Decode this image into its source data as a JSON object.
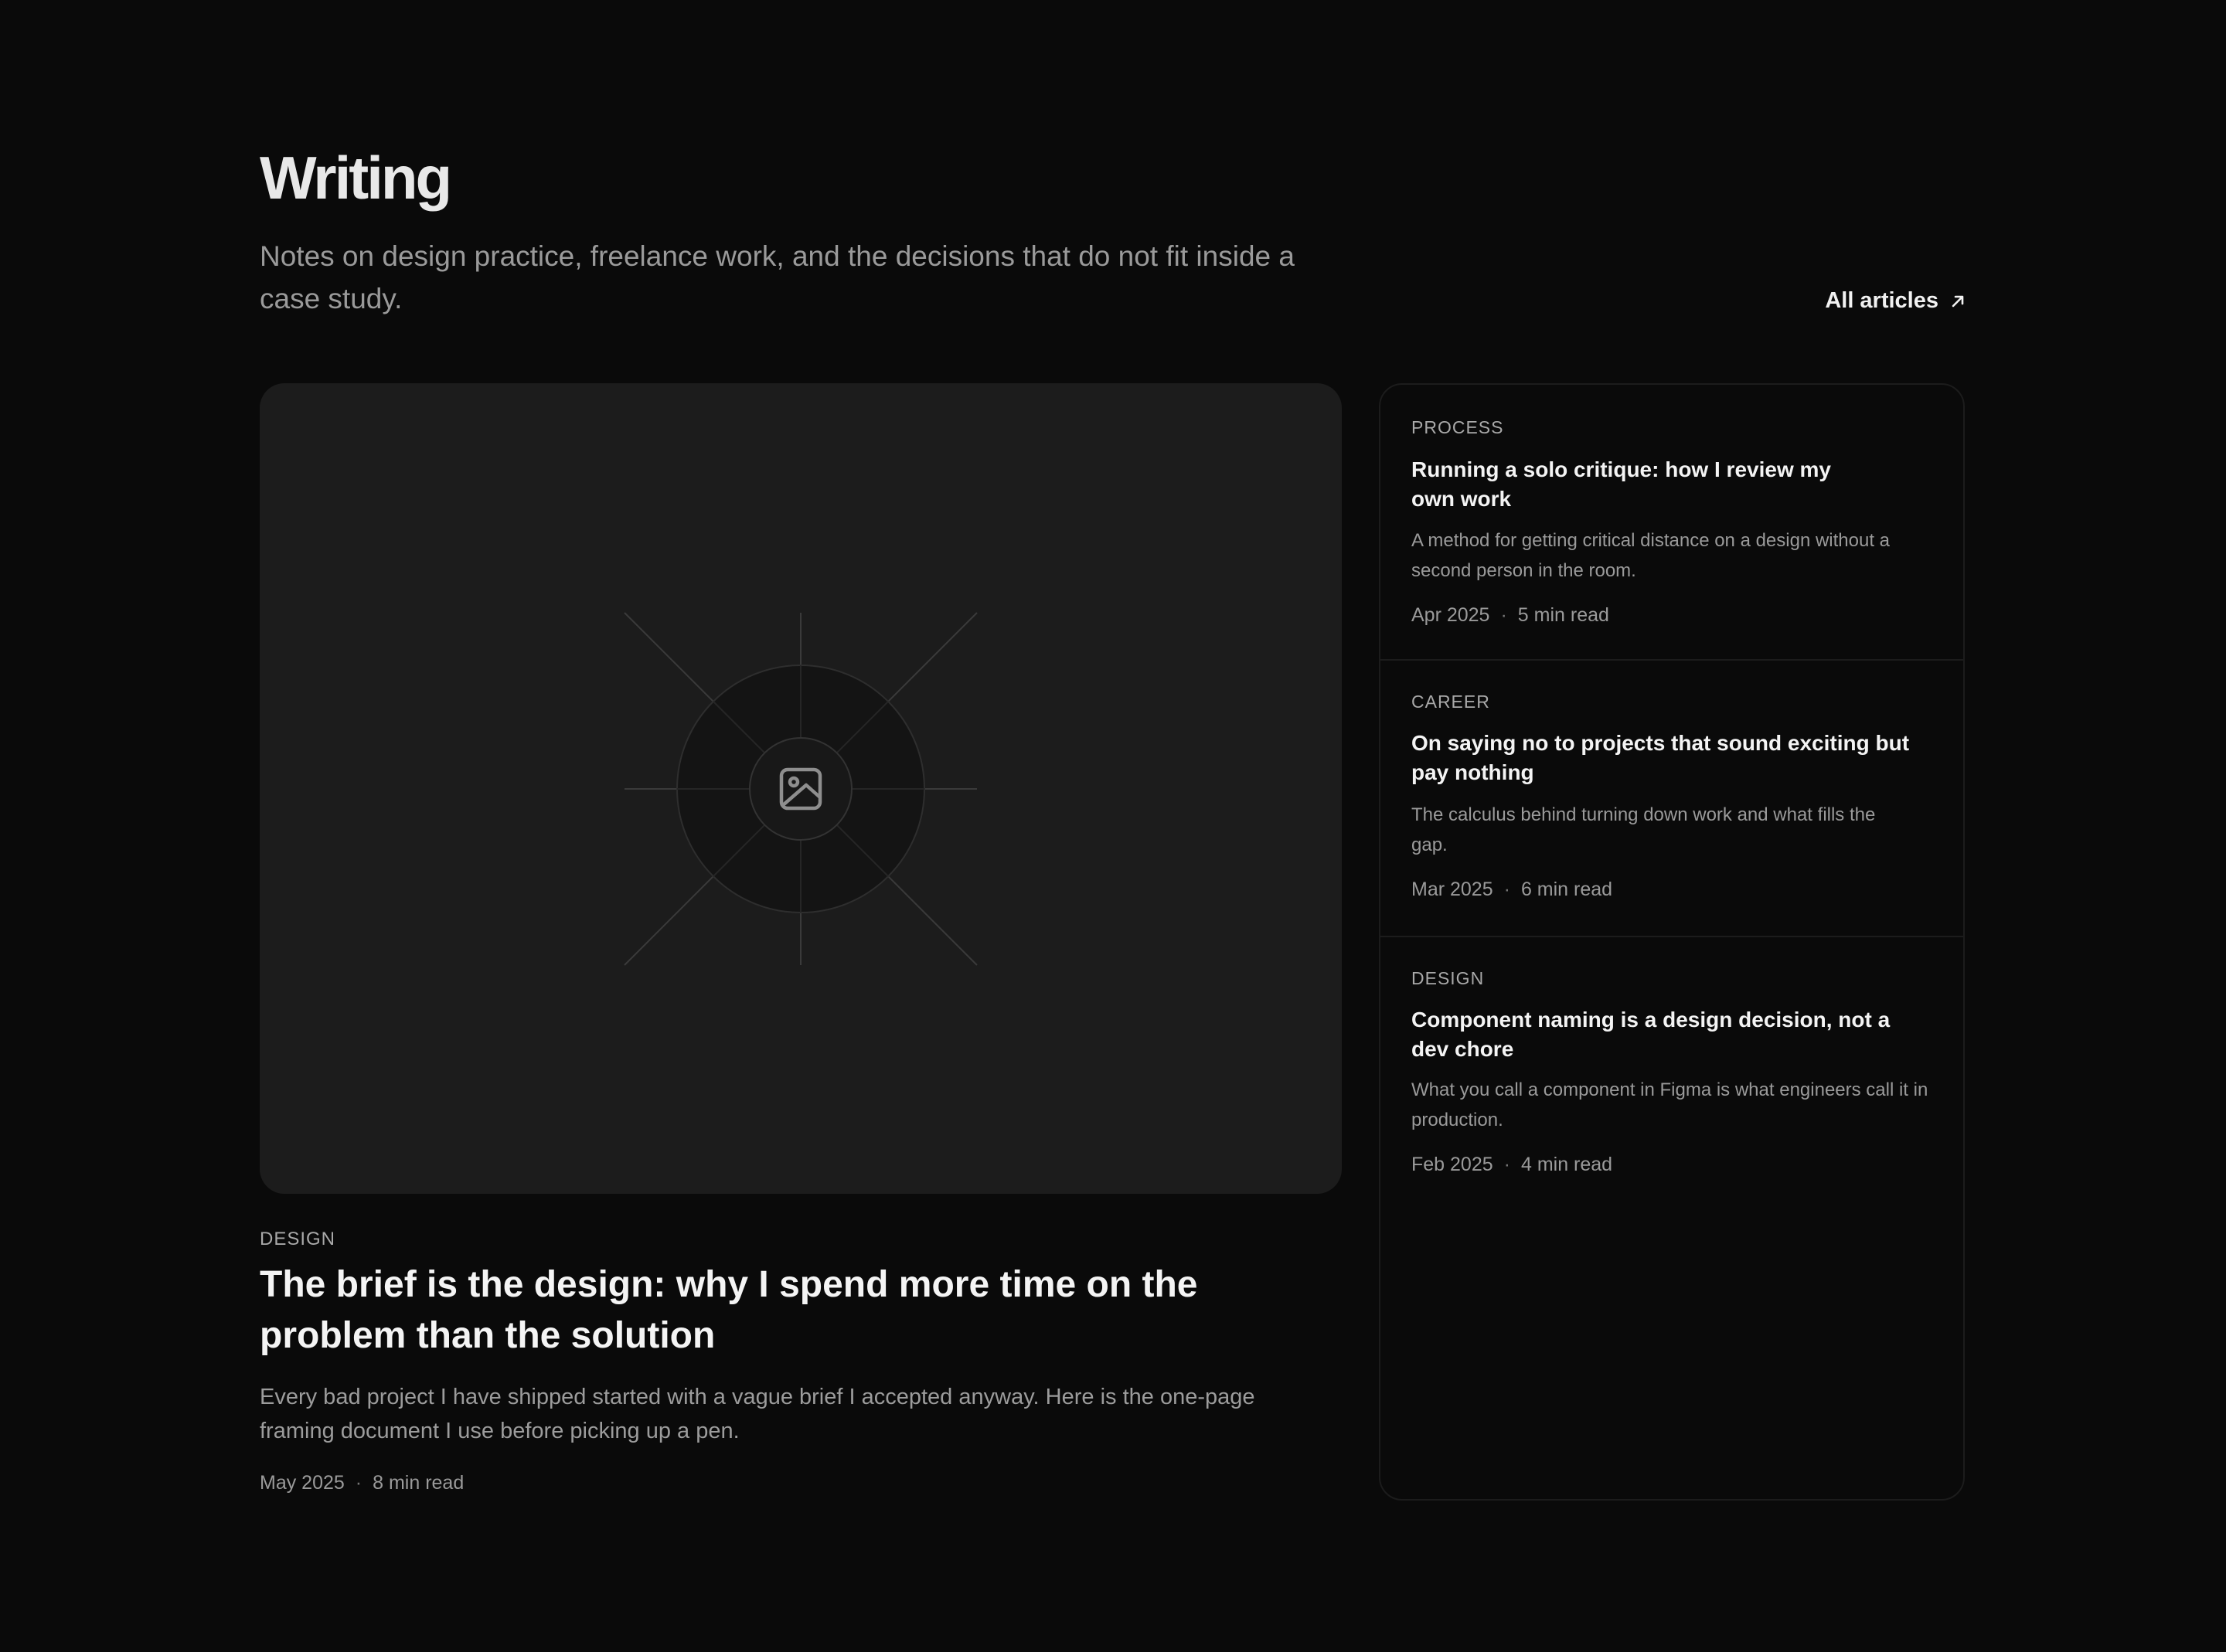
{
  "header": {
    "title": "Writing",
    "subtitle": "Notes on design practice, freelance work, and the decisions that do not fit inside a case study.",
    "all_link_label": "All articles",
    "all_link_icon": "arrow-up-right-icon"
  },
  "featured": {
    "image_icon": "image-icon",
    "tag": "DESIGN",
    "title": "The brief is the design: why I spend more time on the problem than the solution",
    "description": "Every bad project I have shipped started with a vague brief I accepted anyway. Here is the one-page framing document I use before picking up a pen.",
    "date": "May 2025",
    "separator": "·",
    "read_time": "8 min read"
  },
  "articles": [
    {
      "tag": "PROCESS",
      "title": "Running a solo critique: how I review my own work",
      "description": "A method for getting critical distance on a design without a second person in the room.",
      "date": "Apr 2025",
      "separator": "·",
      "read_time": "5 min read"
    },
    {
      "tag": "CAREER",
      "title": "On saying no to projects that sound exciting but pay nothing",
      "description": "The calculus behind turning down work and what fills the gap.",
      "date": "Mar 2025",
      "separator": "·",
      "read_time": "6 min read"
    },
    {
      "tag": "DESIGN",
      "title": "Component naming is a design decision, not a dev chore",
      "description": "What you call a component in Figma is what engineers call it in production.",
      "date": "Feb 2025",
      "separator": "·",
      "read_time": "4 min read"
    }
  ],
  "colors": {
    "background": "#0a0a0a",
    "card": "#1c1c1c",
    "text_primary": "#f4f4f4",
    "text_secondary": "#9a9a9a"
  }
}
